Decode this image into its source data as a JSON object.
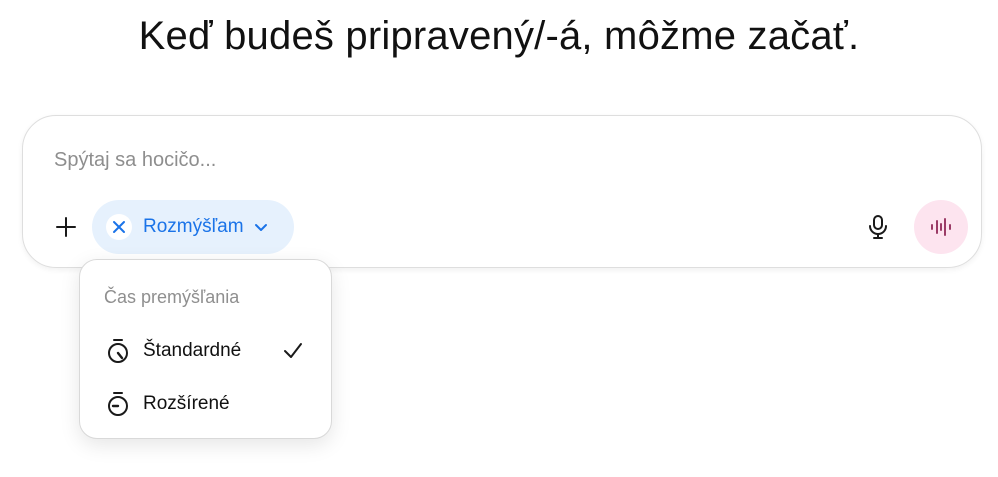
{
  "headline": "Keď budeš pripravený/-á, môžme začať.",
  "composer": {
    "placeholder": "Spýtaj sa hocičo...",
    "value": "",
    "add_icon": "plus-icon",
    "mode_chip": {
      "label": "Rozmýšľam",
      "remove_icon": "close-icon",
      "expand_icon": "chevron-down-icon"
    },
    "dictate_icon": "microphone-icon",
    "voice_icon": "voice-waveform-icon"
  },
  "thinking_menu": {
    "header": "Čas premýšľania",
    "options": [
      {
        "label": "Štandardné",
        "icon": "timer-standard-icon",
        "selected": true
      },
      {
        "label": "Rozšírené",
        "icon": "timer-extended-icon",
        "selected": false
      }
    ]
  },
  "colors": {
    "accent": "#1a73e8",
    "chip_bg": "#e6f1fd",
    "voice_bg": "#fde4ef",
    "placeholder": "#8e8e8e"
  }
}
